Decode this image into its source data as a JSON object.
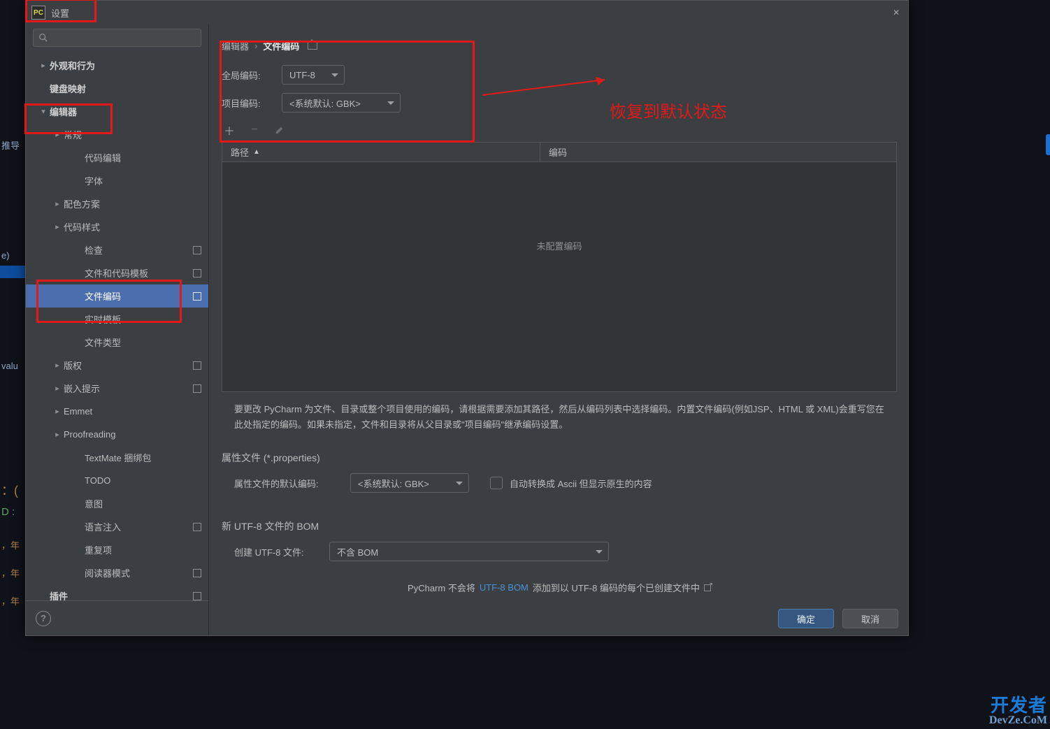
{
  "window": {
    "title": "设置"
  },
  "search": {
    "placeholder": ""
  },
  "tree": [
    {
      "id": "appearance",
      "label": "外观和行为",
      "depth": 0,
      "arrow": "right",
      "bold": true
    },
    {
      "id": "keymap",
      "label": "键盘映射",
      "depth": 0,
      "arrow": "",
      "bold": true
    },
    {
      "id": "editor",
      "label": "编辑器",
      "depth": 0,
      "arrow": "down",
      "bold": true
    },
    {
      "id": "general",
      "label": "常规",
      "depth": 1,
      "arrow": "right"
    },
    {
      "id": "code-edit",
      "label": "代码编辑",
      "depth": 2
    },
    {
      "id": "font",
      "label": "字体",
      "depth": 2
    },
    {
      "id": "color-scheme",
      "label": "配色方案",
      "depth": 1,
      "arrow": "right"
    },
    {
      "id": "code-style",
      "label": "代码样式",
      "depth": 1,
      "arrow": "right"
    },
    {
      "id": "inspections",
      "label": "检查",
      "depth": 2,
      "marked": true
    },
    {
      "id": "file-tpl",
      "label": "文件和代码模板",
      "depth": 2,
      "marked": true
    },
    {
      "id": "file-enc",
      "label": "文件编码",
      "depth": 2,
      "marked": true,
      "selected": true
    },
    {
      "id": "live-tpl",
      "label": "实时模板",
      "depth": 2
    },
    {
      "id": "file-types",
      "label": "文件类型",
      "depth": 2
    },
    {
      "id": "copyright",
      "label": "版权",
      "depth": 1,
      "arrow": "right",
      "marked": true
    },
    {
      "id": "inlay",
      "label": "嵌入提示",
      "depth": 1,
      "arrow": "right",
      "marked": true
    },
    {
      "id": "emmet",
      "label": "Emmet",
      "depth": 1,
      "arrow": "right"
    },
    {
      "id": "proof",
      "label": "Proofreading",
      "depth": 1,
      "arrow": "right"
    },
    {
      "id": "textmate",
      "label": "TextMate 捆绑包",
      "depth": 2
    },
    {
      "id": "todo",
      "label": "TODO",
      "depth": 2
    },
    {
      "id": "intentions",
      "label": "意图",
      "depth": 2
    },
    {
      "id": "lang-inj",
      "label": "语言注入",
      "depth": 2,
      "marked": true
    },
    {
      "id": "duplicates",
      "label": "重复项",
      "depth": 2
    },
    {
      "id": "reader",
      "label": "阅读器模式",
      "depth": 2,
      "marked": true
    },
    {
      "id": "plugins",
      "label": "插件",
      "depth": 0,
      "bold": true,
      "marked": true
    }
  ],
  "breadcrumb": {
    "parent": "编辑器",
    "sep": "›",
    "current": "文件编码"
  },
  "encoding": {
    "globalLabel": "全局编码:",
    "globalValue": "UTF-8",
    "projectLabel": "项目编码:",
    "projectValue": "<系统默认: GBK>"
  },
  "table": {
    "col1": "路径",
    "col2": "编码",
    "emptyText": "未配置编码"
  },
  "helpText": "要更改 PyCharm 为文件、目录或整个项目使用的编码，请根据需要添加其路径，然后从编码列表中选择编码。内置文件编码(例如JSP、HTML 或 XML)会重写您在此处指定的编码。如果未指定，文件和目录将从父目录或\"项目编码\"继承编码设置。",
  "props": {
    "sectionTitle": "属性文件 (*.properties)",
    "defaultLabel": "属性文件的默认编码:",
    "defaultValue": "<系统默认: GBK>",
    "asciiLabel": "自动转换成 Ascii 但显示原生的内容"
  },
  "bom": {
    "sectionTitle": "新 UTF-8 文件的 BOM",
    "createLabel": "创建 UTF-8 文件:",
    "createValue": "不含 BOM",
    "hintPrefix": "PyCharm 不会将",
    "hintLink": "UTF-8 BOM",
    "hintSuffix": "添加到以 UTF-8 编码的每个已创建文件中"
  },
  "buttons": {
    "ok": "确定",
    "cancel": "取消"
  },
  "annotation": {
    "text": "恢复到默认状态"
  },
  "watermark": {
    "line1": "开发者",
    "line2": "DevZe.CoM"
  },
  "underlay": {
    "t1": "推导",
    "t2": "e)",
    "t3": "valu",
    "t4": "：(",
    "t5": "D :",
    "t6": "，年",
    "t7": "，年",
    "t8": "，年"
  }
}
